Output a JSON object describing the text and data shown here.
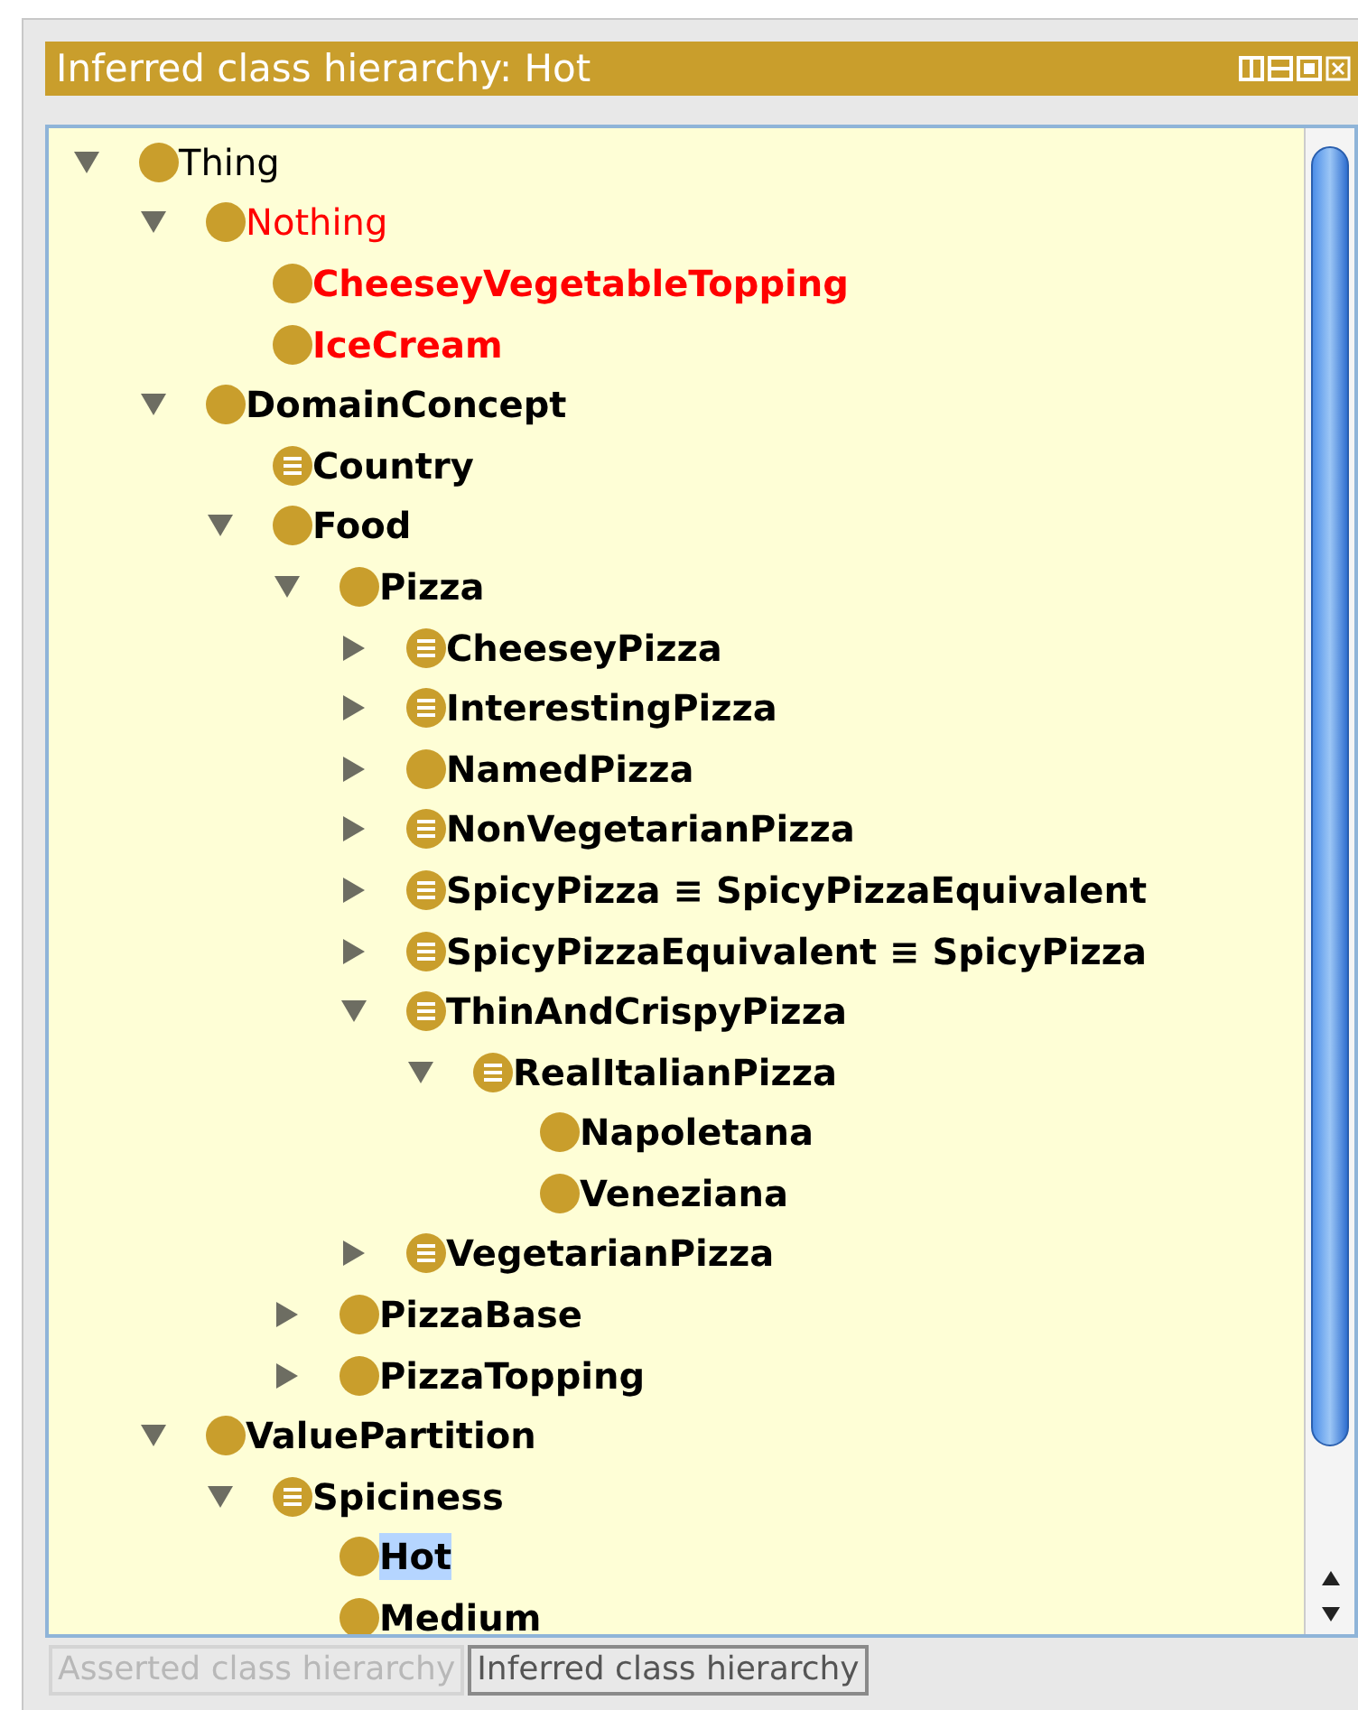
{
  "panel": {
    "title": "Inferred class hierarchy: Hot"
  },
  "tree": [
    {
      "label": "Thing",
      "kind": "primitive",
      "bold": false,
      "unsatisfiable": false,
      "selected": false,
      "expanded": true,
      "children": [
        {
          "label": "Nothing",
          "kind": "primitive",
          "bold": false,
          "unsatisfiable": true,
          "selected": false,
          "expanded": true,
          "children": [
            {
              "label": "CheeseyVegetableTopping",
              "kind": "primitive",
              "bold": true,
              "unsatisfiable": true,
              "selected": false
            },
            {
              "label": "IceCream",
              "kind": "primitive",
              "bold": true,
              "unsatisfiable": true,
              "selected": false
            }
          ]
        },
        {
          "label": "DomainConcept",
          "kind": "primitive",
          "bold": true,
          "unsatisfiable": false,
          "selected": false,
          "expanded": true,
          "children": [
            {
              "label": "Country",
              "kind": "defined",
              "bold": true,
              "unsatisfiable": false,
              "selected": false
            },
            {
              "label": "Food",
              "kind": "primitive",
              "bold": true,
              "unsatisfiable": false,
              "selected": false,
              "expanded": true,
              "children": [
                {
                  "label": "Pizza",
                  "kind": "primitive",
                  "bold": true,
                  "unsatisfiable": false,
                  "selected": false,
                  "expanded": true,
                  "children": [
                    {
                      "label": "CheeseyPizza",
                      "kind": "defined",
                      "bold": true,
                      "unsatisfiable": false,
                      "selected": false,
                      "expanded": false
                    },
                    {
                      "label": "InterestingPizza",
                      "kind": "defined",
                      "bold": true,
                      "unsatisfiable": false,
                      "selected": false,
                      "expanded": false
                    },
                    {
                      "label": "NamedPizza",
                      "kind": "primitive",
                      "bold": true,
                      "unsatisfiable": false,
                      "selected": false,
                      "expanded": false
                    },
                    {
                      "label": "NonVegetarianPizza",
                      "kind": "defined",
                      "bold": true,
                      "unsatisfiable": false,
                      "selected": false,
                      "expanded": false
                    },
                    {
                      "label": "SpicyPizza ≡ SpicyPizzaEquivalent",
                      "kind": "defined",
                      "bold": true,
                      "unsatisfiable": false,
                      "selected": false,
                      "expanded": false
                    },
                    {
                      "label": "SpicyPizzaEquivalent ≡ SpicyPizza",
                      "kind": "defined",
                      "bold": true,
                      "unsatisfiable": false,
                      "selected": false,
                      "expanded": false
                    },
                    {
                      "label": "ThinAndCrispyPizza",
                      "kind": "defined",
                      "bold": true,
                      "unsatisfiable": false,
                      "selected": false,
                      "expanded": true,
                      "children": [
                        {
                          "label": "RealItalianPizza",
                          "kind": "defined",
                          "bold": true,
                          "unsatisfiable": false,
                          "selected": false,
                          "expanded": true,
                          "children": [
                            {
                              "label": "Napoletana",
                              "kind": "primitive",
                              "bold": true,
                              "unsatisfiable": false,
                              "selected": false
                            },
                            {
                              "label": "Veneziana",
                              "kind": "primitive",
                              "bold": true,
                              "unsatisfiable": false,
                              "selected": false
                            }
                          ]
                        }
                      ]
                    },
                    {
                      "label": "VegetarianPizza",
                      "kind": "defined",
                      "bold": true,
                      "unsatisfiable": false,
                      "selected": false,
                      "expanded": false
                    }
                  ]
                },
                {
                  "label": "PizzaBase",
                  "kind": "primitive",
                  "bold": true,
                  "unsatisfiable": false,
                  "selected": false,
                  "expanded": false
                },
                {
                  "label": "PizzaTopping",
                  "kind": "primitive",
                  "bold": true,
                  "unsatisfiable": false,
                  "selected": false,
                  "expanded": false
                }
              ]
            }
          ]
        },
        {
          "label": "ValuePartition",
          "kind": "primitive",
          "bold": true,
          "unsatisfiable": false,
          "selected": false,
          "expanded": true,
          "children": [
            {
              "label": "Spiciness",
              "kind": "defined",
              "bold": true,
              "unsatisfiable": false,
              "selected": false,
              "expanded": true,
              "children": [
                {
                  "label": "Hot",
                  "kind": "primitive",
                  "bold": true,
                  "unsatisfiable": false,
                  "selected": true
                },
                {
                  "label": "Medium",
                  "kind": "primitive",
                  "bold": true,
                  "unsatisfiable": false,
                  "selected": false
                }
              ]
            }
          ]
        }
      ]
    }
  ],
  "tabs": [
    {
      "label": "Asserted class hierarchy",
      "selected": false
    },
    {
      "label": "Inferred class hierarchy",
      "selected": true
    }
  ]
}
